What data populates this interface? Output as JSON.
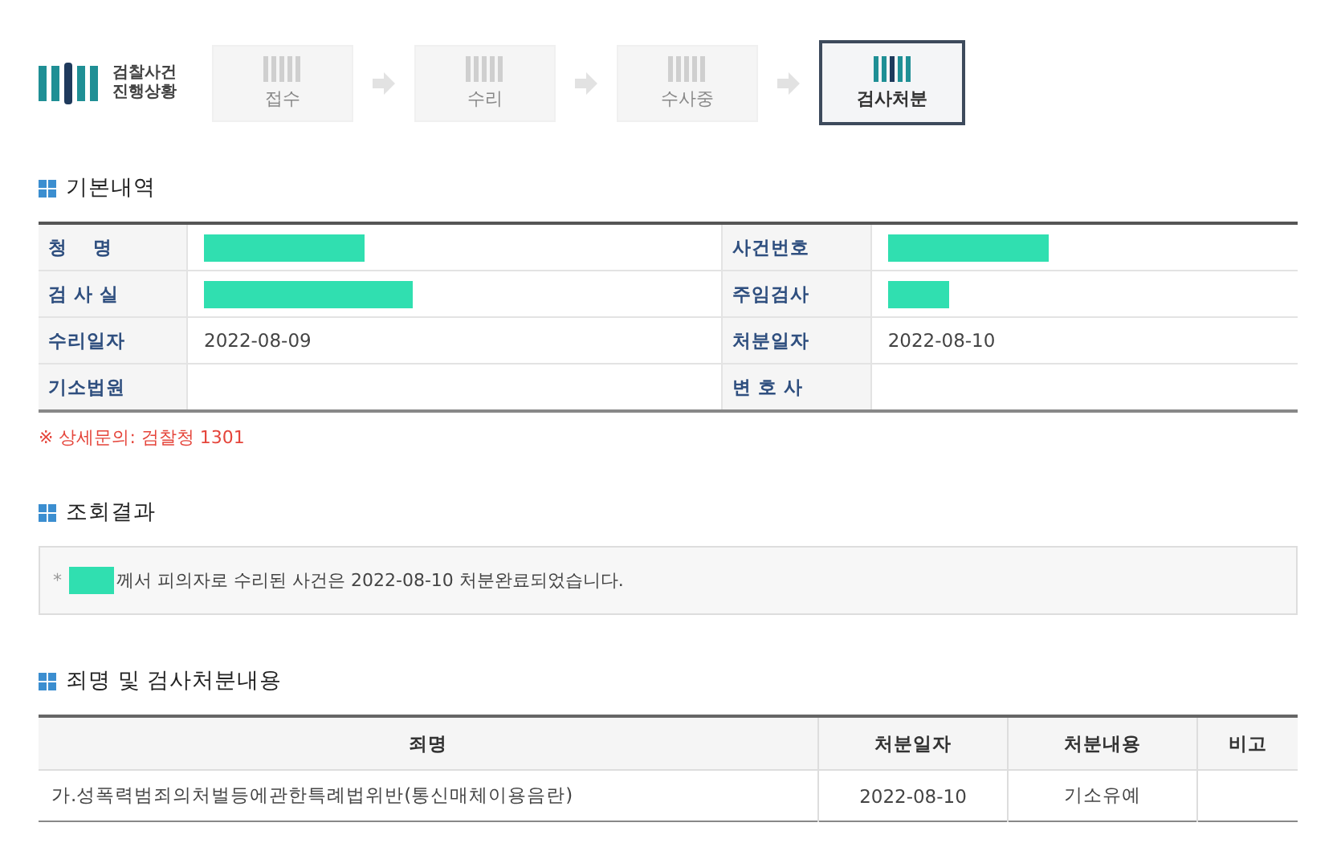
{
  "header": {
    "logo_text": [
      "검찰사건",
      "진행상황"
    ],
    "steps": [
      {
        "label": "접수",
        "selected": false
      },
      {
        "label": "수리",
        "selected": false
      },
      {
        "label": "수사중",
        "selected": false
      },
      {
        "label": "검사처분",
        "selected": true
      }
    ]
  },
  "basic": {
    "title": "기본내역",
    "rows": [
      [
        {
          "label": "청    명",
          "value": {
            "kind": "redacted"
          }
        },
        {
          "label": "사건번호",
          "value": {
            "kind": "redacted"
          }
        }
      ],
      [
        {
          "label": "검 사 실",
          "value": {
            "kind": "redacted_long"
          }
        },
        {
          "label": "주임검사",
          "value": {
            "kind": "redacted_short"
          }
        }
      ],
      [
        {
          "label": "수리일자",
          "value": {
            "kind": "text",
            "text": "2022-08-09"
          }
        },
        {
          "label": "처분일자",
          "value": {
            "kind": "text",
            "text": "2022-08-10"
          }
        }
      ],
      [
        {
          "label": "기소법원",
          "value": {
            "kind": "empty"
          }
        },
        {
          "label": "변 호 사",
          "value": {
            "kind": "empty"
          }
        }
      ]
    ],
    "note": "※ 상세문의: 검찰청 1301"
  },
  "result": {
    "title": "조회결과",
    "bullet": "*",
    "message": "께서 피의자로 수리된 사건은 2022-08-10 처분완료되었습니다."
  },
  "disposition": {
    "title": "죄명 및 검사처분내용",
    "columns": [
      "죄명",
      "처분일자",
      "처분내용",
      "비고"
    ],
    "rows": [
      [
        "가.성폭력범죄의처벌등에관한특례법위반(통신매체이용음란)",
        "2022-08-10",
        "기소유예",
        ""
      ]
    ]
  }
}
